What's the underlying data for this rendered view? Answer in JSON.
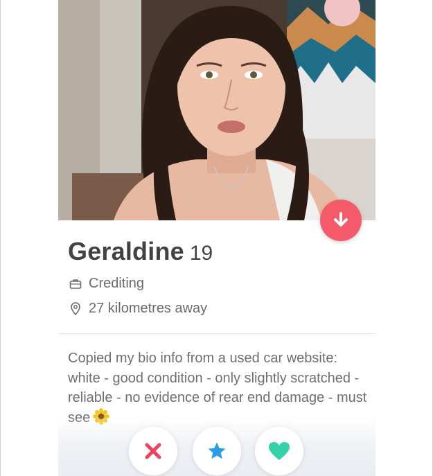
{
  "profile": {
    "name": "Geraldine",
    "age": "19",
    "job": "Crediting",
    "distance": "27 kilometres away",
    "bio": "Copied my bio info from a used car website: white - good condition - only slightly scratched - reliable - no evidence of rear end damage - must see"
  },
  "icons": {
    "down": "arrow-down-icon",
    "job": "briefcase-icon",
    "location": "location-pin-icon",
    "bio_emoji": "sunflower-icon",
    "nope": "close-icon",
    "super_like": "star-icon",
    "like": "heart-icon"
  },
  "colors": {
    "accent": "#f45a6a",
    "nope": "#f2415b",
    "super_like": "#2a9be8",
    "like": "#33d2a8",
    "name_text": "#424242",
    "secondary_text": "#6b6b6b"
  }
}
